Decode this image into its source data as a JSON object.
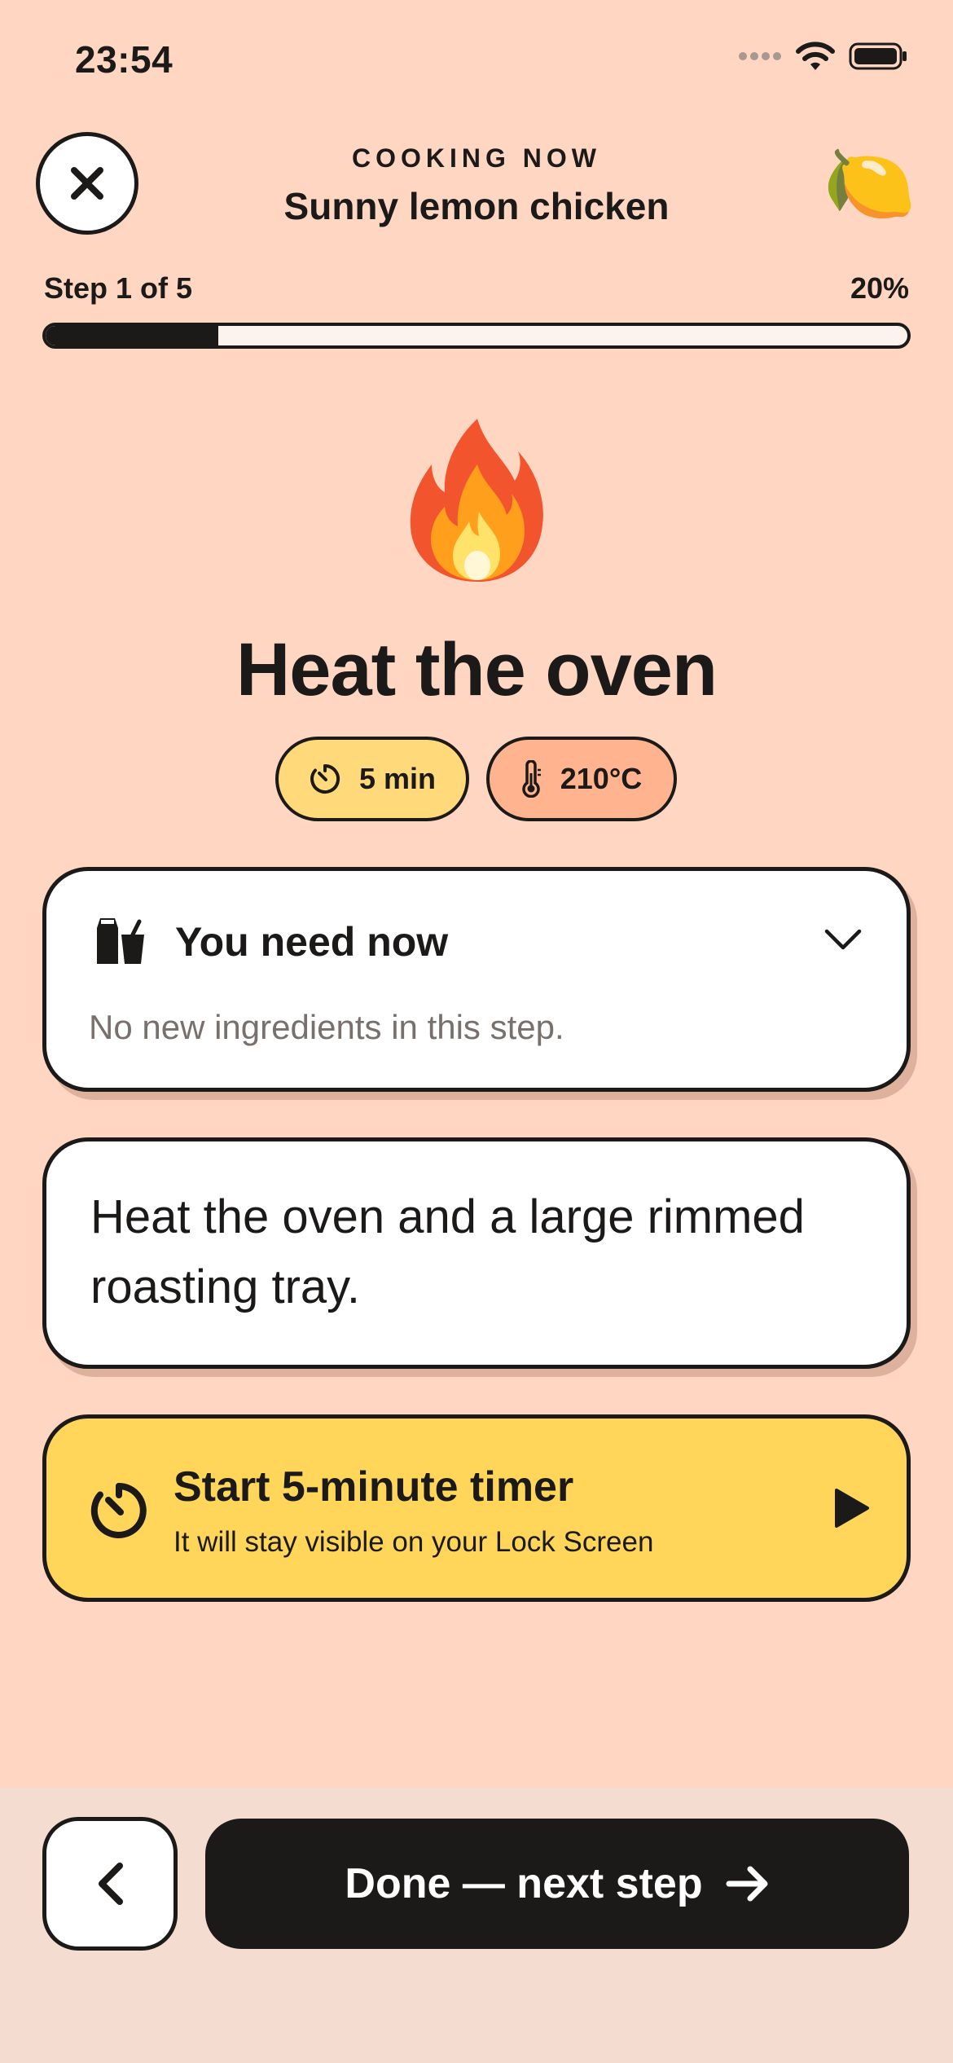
{
  "status_bar": {
    "time": "23:54"
  },
  "header": {
    "eyebrow": "COOKING NOW",
    "recipe_title": "Sunny lemon chicken",
    "recipe_emoji": "🍋"
  },
  "progress": {
    "label": "Step 1 of 5",
    "percent_label": "20%",
    "value": 0.2
  },
  "step": {
    "emoji": "🔥",
    "title": "Heat the oven",
    "chips": {
      "time": "5 min",
      "temp": "210°C"
    }
  },
  "need_card": {
    "title": "You need now",
    "subtitle": "No new ingredients in this step."
  },
  "instruction": "Heat the oven and a large rimmed roasting tray.",
  "timer": {
    "title": "Start 5-minute timer",
    "subtitle": "It will stay visible on your Lock Screen"
  },
  "footer": {
    "next_label": "Done — next step"
  },
  "colors": {
    "background": "#FFD6C2",
    "ink": "#1C1A19",
    "time_chip": "#FFD97A",
    "temp_chip": "#FFB48F",
    "timer_card": "#FFD659",
    "bottom_bar": "#F4DCD0"
  }
}
